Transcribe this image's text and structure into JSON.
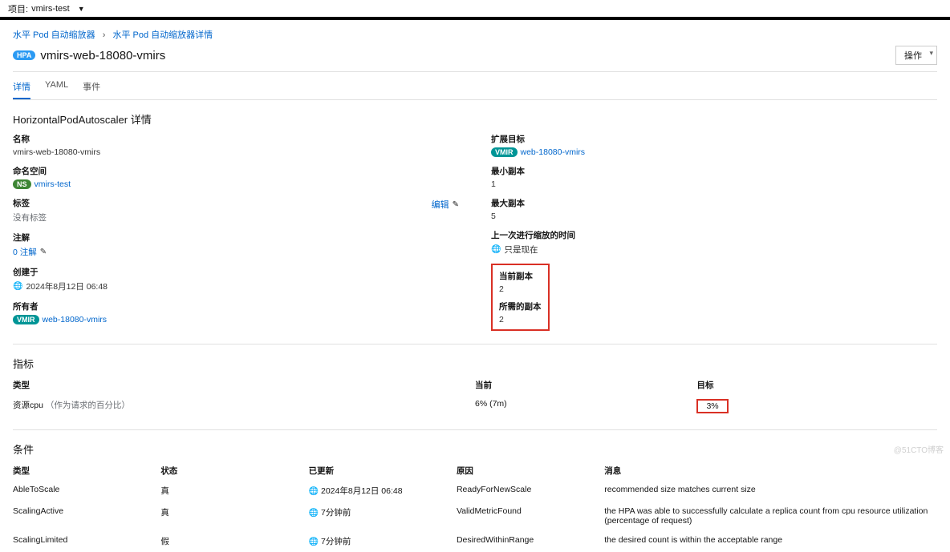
{
  "topbar": {
    "label": "项目:",
    "value": "vmirs-test"
  },
  "breadcrumb": {
    "parent": "水平 Pod 自动缩放器",
    "current": "水平 Pod 自动缩放器详情"
  },
  "header": {
    "badge": "HPA",
    "title": "vmirs-web-18080-vmirs",
    "actions": "操作"
  },
  "tabs": {
    "details": "详情",
    "yaml": "YAML",
    "events": "事件"
  },
  "sectionTitle": "HorizontalPodAutoscaler 详情",
  "left": {
    "name": {
      "label": "名称",
      "value": "vmirs-web-18080-vmirs"
    },
    "namespace": {
      "label": "命名空间",
      "badge": "NS",
      "value": "vmirs-test"
    },
    "labels": {
      "label": "标签",
      "edit": "编辑",
      "value": "没有标签"
    },
    "annotations": {
      "label": "注解",
      "value": "0 注解"
    },
    "created": {
      "label": "创建于",
      "value": "2024年8月12日 06:48"
    },
    "owner": {
      "label": "所有者",
      "badge": "VMIR",
      "value": "web-18080-vmirs"
    }
  },
  "right": {
    "scaleTarget": {
      "label": "扩展目标",
      "badge": "VMIR",
      "value": "web-18080-vmirs"
    },
    "minReplicas": {
      "label": "最小副本",
      "value": "1"
    },
    "maxReplicas": {
      "label": "最大副本",
      "value": "5"
    },
    "lastScale": {
      "label": "上一次进行缩放的时间",
      "value": "只是现在"
    },
    "currentReplicas": {
      "label": "当前副本",
      "value": "2"
    },
    "desiredReplicas": {
      "label": "所需的副本",
      "value": "2"
    }
  },
  "metrics": {
    "title": "指标",
    "head": {
      "type": "类型",
      "current": "当前",
      "target": "目标"
    },
    "row": {
      "type": "资源cpu",
      "note": "（作为请求的百分比）",
      "current": "6% (7m)",
      "target": "3%"
    }
  },
  "conditions": {
    "title": "条件",
    "head": {
      "type": "类型",
      "status": "状态",
      "updated": "已更新",
      "reason": "原因",
      "message": "消息"
    },
    "rows": [
      {
        "type": "AbleToScale",
        "status": "真",
        "updated": "2024年8月12日 06:48",
        "globe": true,
        "reason": "ReadyForNewScale",
        "message": "recommended size matches current size"
      },
      {
        "type": "ScalingActive",
        "status": "真",
        "updated": "7分钟前",
        "globe": true,
        "reason": "ValidMetricFound",
        "message": "the HPA was able to successfully calculate a replica count from cpu resource utilization (percentage of request)"
      },
      {
        "type": "ScalingLimited",
        "status": "假",
        "updated": "7分钟前",
        "globe": true,
        "reason": "DesiredWithinRange",
        "message": "the desired count is within the acceptable range"
      }
    ]
  },
  "watermark": "@51CTO博客"
}
